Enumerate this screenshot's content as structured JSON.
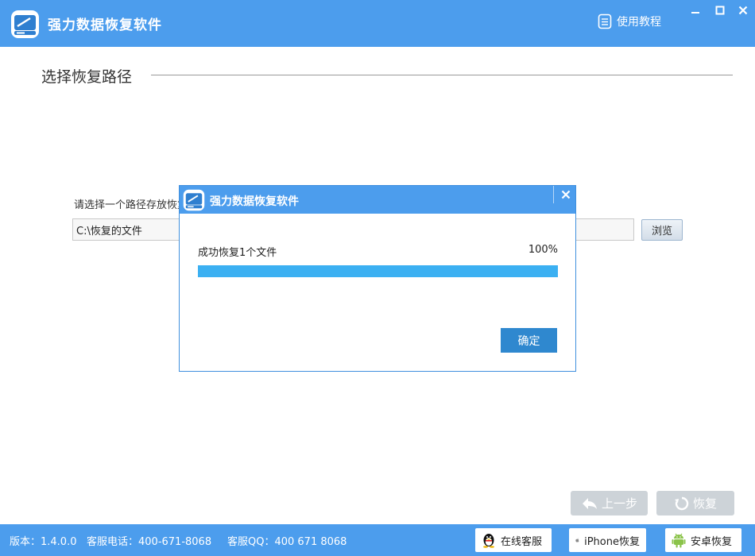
{
  "app": {
    "title": "强力数据恢复软件"
  },
  "header": {
    "tutorial_label": "使用教程"
  },
  "main": {
    "section_title": "选择恢复路径",
    "path_label": "请选择一个路径存放恢复的文件",
    "path_value": "C:\\恢复的文件",
    "browse_label": "浏览",
    "prev_label": "上一步",
    "recover_label": "恢复"
  },
  "statusbar": {
    "version": "版本：1.4.0.0",
    "phone": "客服电话：400-671-8068",
    "qq": "客服QQ：400 671 8068",
    "online_service_label": "在线客服",
    "iphone_recover_label": "iPhone恢复",
    "android_recover_label": "安卓恢复"
  },
  "dialog": {
    "title": "强力数据恢复软件",
    "message": "成功恢复1个文件",
    "percent_text": "100%",
    "progress": 1.0,
    "ok_label": "确定"
  },
  "icons": {
    "app_logo": "hard-drive-icon",
    "tutorial": "document-icon",
    "minimize": "minimize-icon",
    "maximize": "maximize-icon",
    "close": "close-icon",
    "back": "back-arrow-icon",
    "recover": "refresh-icon",
    "qq": "qq-penguin-icon",
    "apple": "apple-icon",
    "android": "android-icon"
  },
  "colors": {
    "titlebar": "#4c9ded",
    "progress_fill": "#3bb0f2",
    "ok_button": "#2f88cf",
    "disabled_button": "#cdd3d8"
  }
}
